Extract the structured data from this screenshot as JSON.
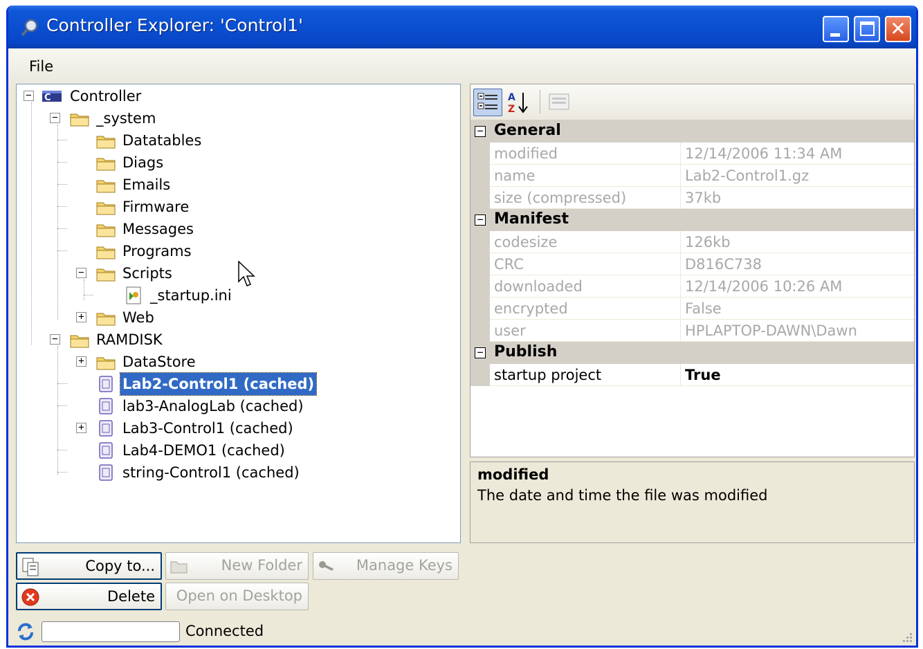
{
  "window": {
    "title": "Controller Explorer: 'Control1'"
  },
  "menu": {
    "file": "File"
  },
  "tree": {
    "root": "Controller",
    "system": "_system",
    "system_children": [
      "Datatables",
      "Diags",
      "Emails",
      "Firmware",
      "Messages",
      "Programs"
    ],
    "scripts": "Scripts",
    "startup_ini": "_startup.ini",
    "web": "Web",
    "ramdisk": "RAMDISK",
    "datastore": "DataStore",
    "projects": [
      "Lab2-Control1 (cached)",
      "lab3-AnalogLab (cached)",
      "Lab3-Control1 (cached)",
      "Lab4-DEMO1 (cached)",
      "string-Control1 (cached)"
    ],
    "selected": "Lab2-Control1 (cached)"
  },
  "properties": {
    "categories": {
      "general": "General",
      "manifest": "Manifest",
      "publish": "Publish"
    },
    "general": [
      {
        "name": "modified",
        "value": "12/14/2006 11:34 AM"
      },
      {
        "name": "name",
        "value": "Lab2-Control1.gz"
      },
      {
        "name": "size (compressed)",
        "value": "37kb"
      }
    ],
    "manifest": [
      {
        "name": "codesize",
        "value": "126kb"
      },
      {
        "name": "CRC",
        "value": "D816C738"
      },
      {
        "name": "downloaded",
        "value": "12/14/2006 10:26 AM"
      },
      {
        "name": "encrypted",
        "value": "False"
      },
      {
        "name": "user",
        "value": "HPLAPTOP-DAWN\\Dawn"
      }
    ],
    "publish": [
      {
        "name": "startup project",
        "value": "True"
      }
    ]
  },
  "description": {
    "title": "modified",
    "text": "The date and time the file was modified"
  },
  "buttons": {
    "copy_to": "Copy to...",
    "new_folder": "New Folder",
    "manage_keys": "Manage Keys",
    "delete": "Delete",
    "open_on_desktop": "Open on Desktop"
  },
  "status": {
    "text": "Connected"
  },
  "colors": {
    "title_bar": "#0a4fd0",
    "selection": "#316ac5",
    "folder": "#f5d26a"
  }
}
